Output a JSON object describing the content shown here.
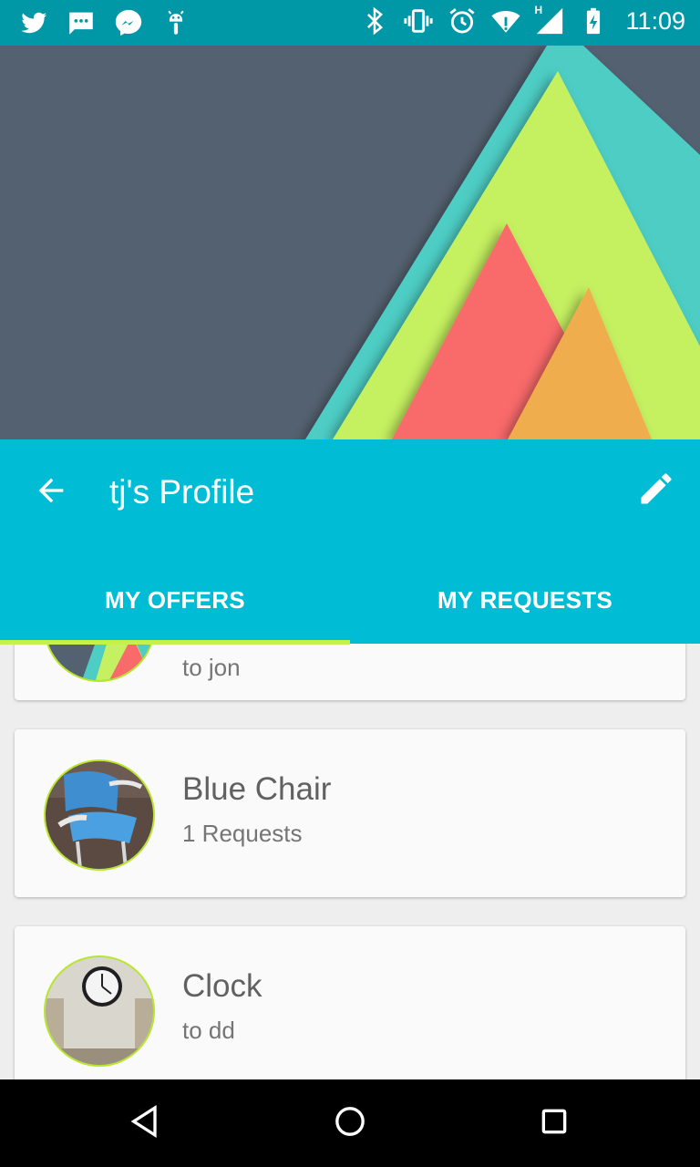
{
  "status_bar": {
    "time": "11:09",
    "left_icons": [
      "twitter-icon",
      "sms-icon",
      "messenger-icon",
      "android-debug-icon"
    ],
    "right_icons": [
      "bluetooth-icon",
      "vibrate-icon",
      "alarm-icon",
      "wifi-icon",
      "cell-signal-icon",
      "battery-charging-icon"
    ],
    "network_label": "H"
  },
  "colors": {
    "status_bar": "#0097a7",
    "toolbar": "#00bcd4",
    "tab_indicator": "#c6f04d",
    "header_bg": "#546170",
    "avatar_ring": "#b8e62a"
  },
  "toolbar": {
    "title": "tj's Profile",
    "back_icon": "arrow-back-icon",
    "edit_icon": "pencil-icon"
  },
  "tabs": [
    {
      "label": "MY OFFERS",
      "selected": true
    },
    {
      "label": "MY REQUESTS",
      "selected": false
    }
  ],
  "offers": [
    {
      "title": "",
      "subtitle": "to jon",
      "thumbnail": "default-art"
    },
    {
      "title": "Blue Chair",
      "subtitle": "1 Requests",
      "thumbnail": "blue-chair-photo"
    },
    {
      "title": "Clock",
      "subtitle": "to dd",
      "thumbnail": "clock-photo"
    }
  ],
  "nav_bar": {
    "back": "nav-back-icon",
    "home": "nav-home-icon",
    "recents": "nav-recents-icon"
  }
}
